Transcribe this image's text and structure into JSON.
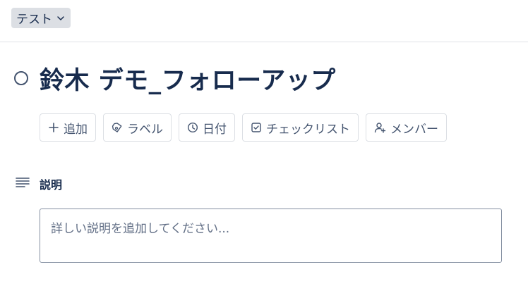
{
  "list": {
    "name": "テスト",
    "icon": "chevron-down-icon"
  },
  "card": {
    "title": "鈴木 デモ_フォローアップ",
    "complete_icon": "circle-icon"
  },
  "actions": [
    {
      "label": "追加",
      "icon": "plus-icon"
    },
    {
      "label": "ラベル",
      "icon": "tag-icon"
    },
    {
      "label": "日付",
      "icon": "clock-icon"
    },
    {
      "label": "チェックリスト",
      "icon": "checkbox-icon"
    },
    {
      "label": "メンバー",
      "icon": "add-person-icon"
    }
  ],
  "description": {
    "heading": "説明",
    "icon": "description-lines-icon",
    "placeholder": "詳しい説明を追加してください..."
  },
  "colors": {
    "text": "#172b4d",
    "subtle_text": "#44546f",
    "chip_bg": "#dcdfe4",
    "border": "#dcdfe4",
    "input_border": "#8590a2"
  }
}
